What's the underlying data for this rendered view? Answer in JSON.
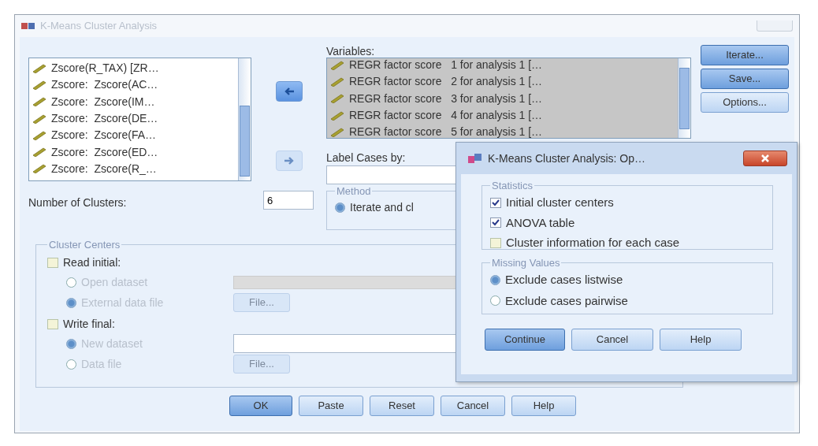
{
  "window": {
    "title": "K-Means Cluster Analysis"
  },
  "source_list": {
    "items": [
      {
        "label": "Zscore(R_TAX) [ZR…",
        "selected": false
      },
      {
        "label": "Zscore:  Zscore(AC…",
        "selected": false
      },
      {
        "label": "Zscore:  Zscore(IM…",
        "selected": false
      },
      {
        "label": "Zscore:  Zscore(DE…",
        "selected": false
      },
      {
        "label": "Zscore:  Zscore(FA…",
        "selected": false
      },
      {
        "label": "Zscore:  Zscore(ED…",
        "selected": false
      },
      {
        "label": "Zscore:  Zscore(R_…",
        "selected": false
      }
    ]
  },
  "arrow_buttons": [
    {
      "kind": "left",
      "disabled": false
    },
    {
      "kind": "right",
      "disabled": true
    }
  ],
  "variables": {
    "label": "Variables:",
    "items": [
      {
        "label": "REGR factor score   1 for analysis 1 […",
        "selected": true
      },
      {
        "label": "REGR factor score   2 for analysis 1 […",
        "selected": true
      },
      {
        "label": "REGR factor score   3 for analysis 1 […",
        "selected": true
      },
      {
        "label": "REGR factor score   4 for analysis 1 […",
        "selected": true
      },
      {
        "label": "REGR factor score   5 for analysis 1 […",
        "selected": true
      }
    ]
  },
  "side_buttons": [
    {
      "label": "Iterate...",
      "highlighted": true
    },
    {
      "label": "Save...",
      "highlighted": true
    },
    {
      "label": "Options...",
      "highlighted": false
    }
  ],
  "label_cases": {
    "label": "Label Cases by:"
  },
  "clusters": {
    "label": "Number of Clusters:",
    "value": "6"
  },
  "method": {
    "title": "Method",
    "options": [
      {
        "label": "Iterate and cl",
        "selected": true
      }
    ]
  },
  "cluster_centers": {
    "title": "Cluster Centers",
    "sections": [
      {
        "label": "Read initial:",
        "checked": false,
        "options": [
          {
            "label": "Open dataset",
            "selected": false,
            "disabled": true,
            "kind": "dropdown"
          },
          {
            "label": "External data file",
            "selected": true,
            "disabled": true,
            "kind": "button",
            "button": "File..."
          }
        ]
      },
      {
        "label": "Write final:",
        "checked": false,
        "options": [
          {
            "label": "New dataset",
            "selected": true,
            "disabled": true,
            "kind": "field"
          },
          {
            "label": "Data file",
            "selected": false,
            "disabled": true,
            "kind": "button",
            "button": "File..."
          }
        ]
      }
    ]
  },
  "buttons": [
    {
      "label": "OK",
      "highlighted": true
    },
    {
      "label": "Paste",
      "highlighted": false
    },
    {
      "label": "Reset",
      "highlighted": false
    },
    {
      "label": "Cancel",
      "highlighted": false
    },
    {
      "label": "Help",
      "highlighted": false
    }
  ],
  "options_dialog": {
    "title": "K-Means Cluster Analysis: Op…",
    "statistics": {
      "title": "Statistics",
      "items": [
        {
          "label": "Initial cluster centers",
          "checked": true
        },
        {
          "label": "ANOVA table",
          "checked": true
        },
        {
          "label": "Cluster information for each case",
          "checked": false
        }
      ]
    },
    "missing_values": {
      "title": "Missing Values",
      "options": [
        {
          "label": "Exclude cases listwise",
          "selected": true
        },
        {
          "label": "Exclude cases pairwise",
          "selected": false
        }
      ]
    },
    "buttons": [
      {
        "label": "Continue",
        "highlighted": true
      },
      {
        "label": "Cancel",
        "highlighted": false
      },
      {
        "label": "Help",
        "highlighted": false
      }
    ]
  }
}
